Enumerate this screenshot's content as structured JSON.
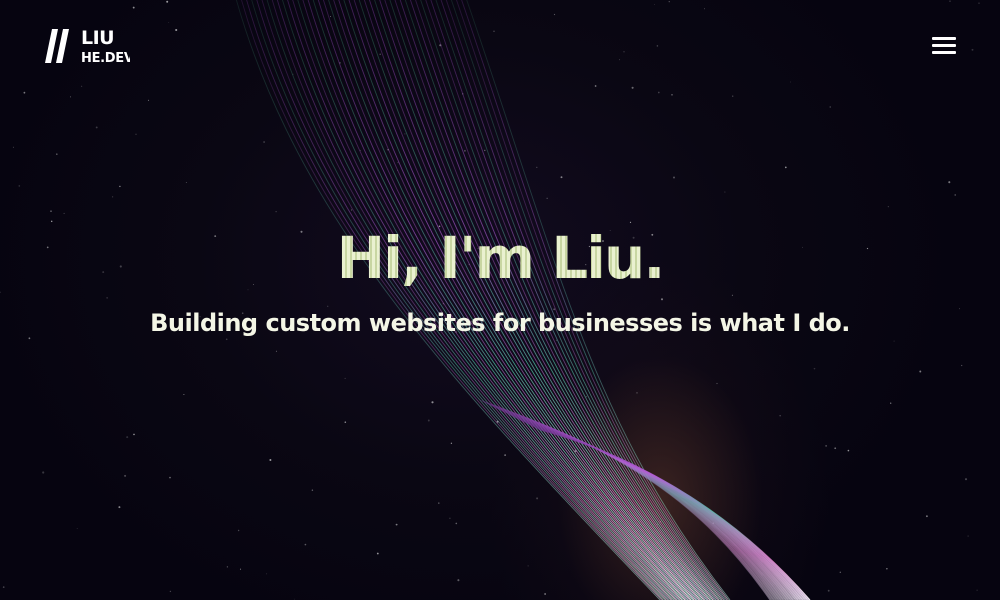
{
  "logo": {
    "line1": "LIU",
    "line2": "HE.DEV",
    "slashes": "//"
  },
  "header": {
    "menu_icon": "hamburger-menu-icon"
  },
  "hero": {
    "title": "Hi, I'm Liu.",
    "subtitle": "Building custom websites for businesses is what I do."
  },
  "colors": {
    "background": "#07050e",
    "title": "#dde8bf",
    "subtitle": "#f4f6e6",
    "ribbon_purple": "#a45ad6",
    "ribbon_green": "#5fd49a",
    "ribbon_pink": "#e07ac8",
    "ribbon_white": "#ffffff"
  }
}
